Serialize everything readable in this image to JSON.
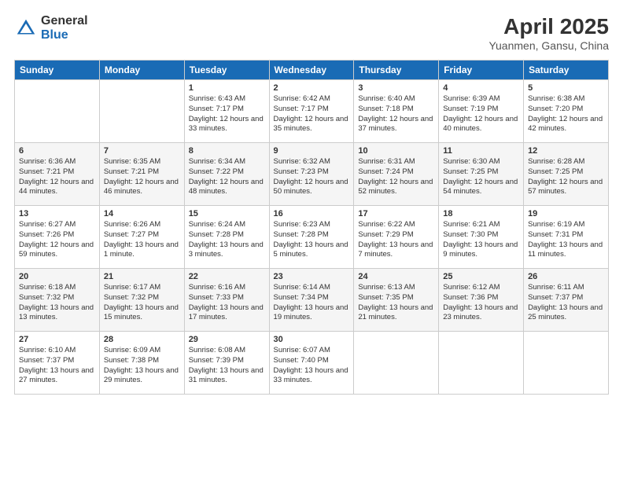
{
  "header": {
    "logo_general": "General",
    "logo_blue": "Blue",
    "month_year": "April 2025",
    "location": "Yuanmen, Gansu, China"
  },
  "days_of_week": [
    "Sunday",
    "Monday",
    "Tuesday",
    "Wednesday",
    "Thursday",
    "Friday",
    "Saturday"
  ],
  "weeks": [
    [
      {
        "day": "",
        "info": ""
      },
      {
        "day": "",
        "info": ""
      },
      {
        "day": "1",
        "info": "Sunrise: 6:43 AM\nSunset: 7:17 PM\nDaylight: 12 hours\nand 33 minutes."
      },
      {
        "day": "2",
        "info": "Sunrise: 6:42 AM\nSunset: 7:17 PM\nDaylight: 12 hours\nand 35 minutes."
      },
      {
        "day": "3",
        "info": "Sunrise: 6:40 AM\nSunset: 7:18 PM\nDaylight: 12 hours\nand 37 minutes."
      },
      {
        "day": "4",
        "info": "Sunrise: 6:39 AM\nSunset: 7:19 PM\nDaylight: 12 hours\nand 40 minutes."
      },
      {
        "day": "5",
        "info": "Sunrise: 6:38 AM\nSunset: 7:20 PM\nDaylight: 12 hours\nand 42 minutes."
      }
    ],
    [
      {
        "day": "6",
        "info": "Sunrise: 6:36 AM\nSunset: 7:21 PM\nDaylight: 12 hours\nand 44 minutes."
      },
      {
        "day": "7",
        "info": "Sunrise: 6:35 AM\nSunset: 7:21 PM\nDaylight: 12 hours\nand 46 minutes."
      },
      {
        "day": "8",
        "info": "Sunrise: 6:34 AM\nSunset: 7:22 PM\nDaylight: 12 hours\nand 48 minutes."
      },
      {
        "day": "9",
        "info": "Sunrise: 6:32 AM\nSunset: 7:23 PM\nDaylight: 12 hours\nand 50 minutes."
      },
      {
        "day": "10",
        "info": "Sunrise: 6:31 AM\nSunset: 7:24 PM\nDaylight: 12 hours\nand 52 minutes."
      },
      {
        "day": "11",
        "info": "Sunrise: 6:30 AM\nSunset: 7:25 PM\nDaylight: 12 hours\nand 54 minutes."
      },
      {
        "day": "12",
        "info": "Sunrise: 6:28 AM\nSunset: 7:25 PM\nDaylight: 12 hours\nand 57 minutes."
      }
    ],
    [
      {
        "day": "13",
        "info": "Sunrise: 6:27 AM\nSunset: 7:26 PM\nDaylight: 12 hours\nand 59 minutes."
      },
      {
        "day": "14",
        "info": "Sunrise: 6:26 AM\nSunset: 7:27 PM\nDaylight: 13 hours\nand 1 minute."
      },
      {
        "day": "15",
        "info": "Sunrise: 6:24 AM\nSunset: 7:28 PM\nDaylight: 13 hours\nand 3 minutes."
      },
      {
        "day": "16",
        "info": "Sunrise: 6:23 AM\nSunset: 7:28 PM\nDaylight: 13 hours\nand 5 minutes."
      },
      {
        "day": "17",
        "info": "Sunrise: 6:22 AM\nSunset: 7:29 PM\nDaylight: 13 hours\nand 7 minutes."
      },
      {
        "day": "18",
        "info": "Sunrise: 6:21 AM\nSunset: 7:30 PM\nDaylight: 13 hours\nand 9 minutes."
      },
      {
        "day": "19",
        "info": "Sunrise: 6:19 AM\nSunset: 7:31 PM\nDaylight: 13 hours\nand 11 minutes."
      }
    ],
    [
      {
        "day": "20",
        "info": "Sunrise: 6:18 AM\nSunset: 7:32 PM\nDaylight: 13 hours\nand 13 minutes."
      },
      {
        "day": "21",
        "info": "Sunrise: 6:17 AM\nSunset: 7:32 PM\nDaylight: 13 hours\nand 15 minutes."
      },
      {
        "day": "22",
        "info": "Sunrise: 6:16 AM\nSunset: 7:33 PM\nDaylight: 13 hours\nand 17 minutes."
      },
      {
        "day": "23",
        "info": "Sunrise: 6:14 AM\nSunset: 7:34 PM\nDaylight: 13 hours\nand 19 minutes."
      },
      {
        "day": "24",
        "info": "Sunrise: 6:13 AM\nSunset: 7:35 PM\nDaylight: 13 hours\nand 21 minutes."
      },
      {
        "day": "25",
        "info": "Sunrise: 6:12 AM\nSunset: 7:36 PM\nDaylight: 13 hours\nand 23 minutes."
      },
      {
        "day": "26",
        "info": "Sunrise: 6:11 AM\nSunset: 7:37 PM\nDaylight: 13 hours\nand 25 minutes."
      }
    ],
    [
      {
        "day": "27",
        "info": "Sunrise: 6:10 AM\nSunset: 7:37 PM\nDaylight: 13 hours\nand 27 minutes."
      },
      {
        "day": "28",
        "info": "Sunrise: 6:09 AM\nSunset: 7:38 PM\nDaylight: 13 hours\nand 29 minutes."
      },
      {
        "day": "29",
        "info": "Sunrise: 6:08 AM\nSunset: 7:39 PM\nDaylight: 13 hours\nand 31 minutes."
      },
      {
        "day": "30",
        "info": "Sunrise: 6:07 AM\nSunset: 7:40 PM\nDaylight: 13 hours\nand 33 minutes."
      },
      {
        "day": "",
        "info": ""
      },
      {
        "day": "",
        "info": ""
      },
      {
        "day": "",
        "info": ""
      }
    ]
  ]
}
